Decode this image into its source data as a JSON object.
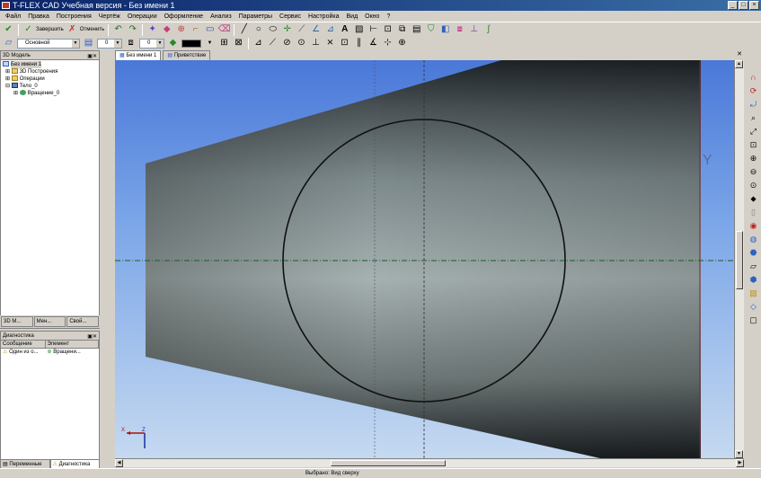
{
  "window": {
    "title": "T-FLEX CAD Учебная версия - Без имени 1"
  },
  "menu": [
    "Файл",
    "Правка",
    "Построения",
    "Чертёж",
    "Операции",
    "Оформление",
    "Анализ",
    "Параметры",
    "Сервис",
    "Настройка",
    "Вид",
    "Окно",
    "?"
  ],
  "toolbar": {
    "finish_label": "Завершить",
    "cancel_label": "Отменить"
  },
  "toolbar2": {
    "layer": "Основной",
    "value1": "0",
    "value2": "0"
  },
  "model_pane": {
    "title": "3D Модель",
    "items": [
      "Без имени 1",
      "3D Построения",
      "Операции",
      "Тело_0",
      "Вращение_0"
    ],
    "tabs": [
      "3D М...",
      "Мен...",
      "Свой..."
    ]
  },
  "diag_pane": {
    "title": "Диагностика",
    "columns": [
      "Сообщение",
      "Элемент"
    ],
    "rows": [
      {
        "message": "Один из о...",
        "element": "Вращени..."
      }
    ]
  },
  "bottom_tabs": [
    "Переменные",
    "Диагностика"
  ],
  "doc_tabs": [
    "Без имени 1",
    "Приветствие"
  ],
  "viewport": {
    "axis_x": "X",
    "axis_z": "Z",
    "axis_y": "Y"
  },
  "status": {
    "text": "Выбрано: Вид сверху"
  }
}
